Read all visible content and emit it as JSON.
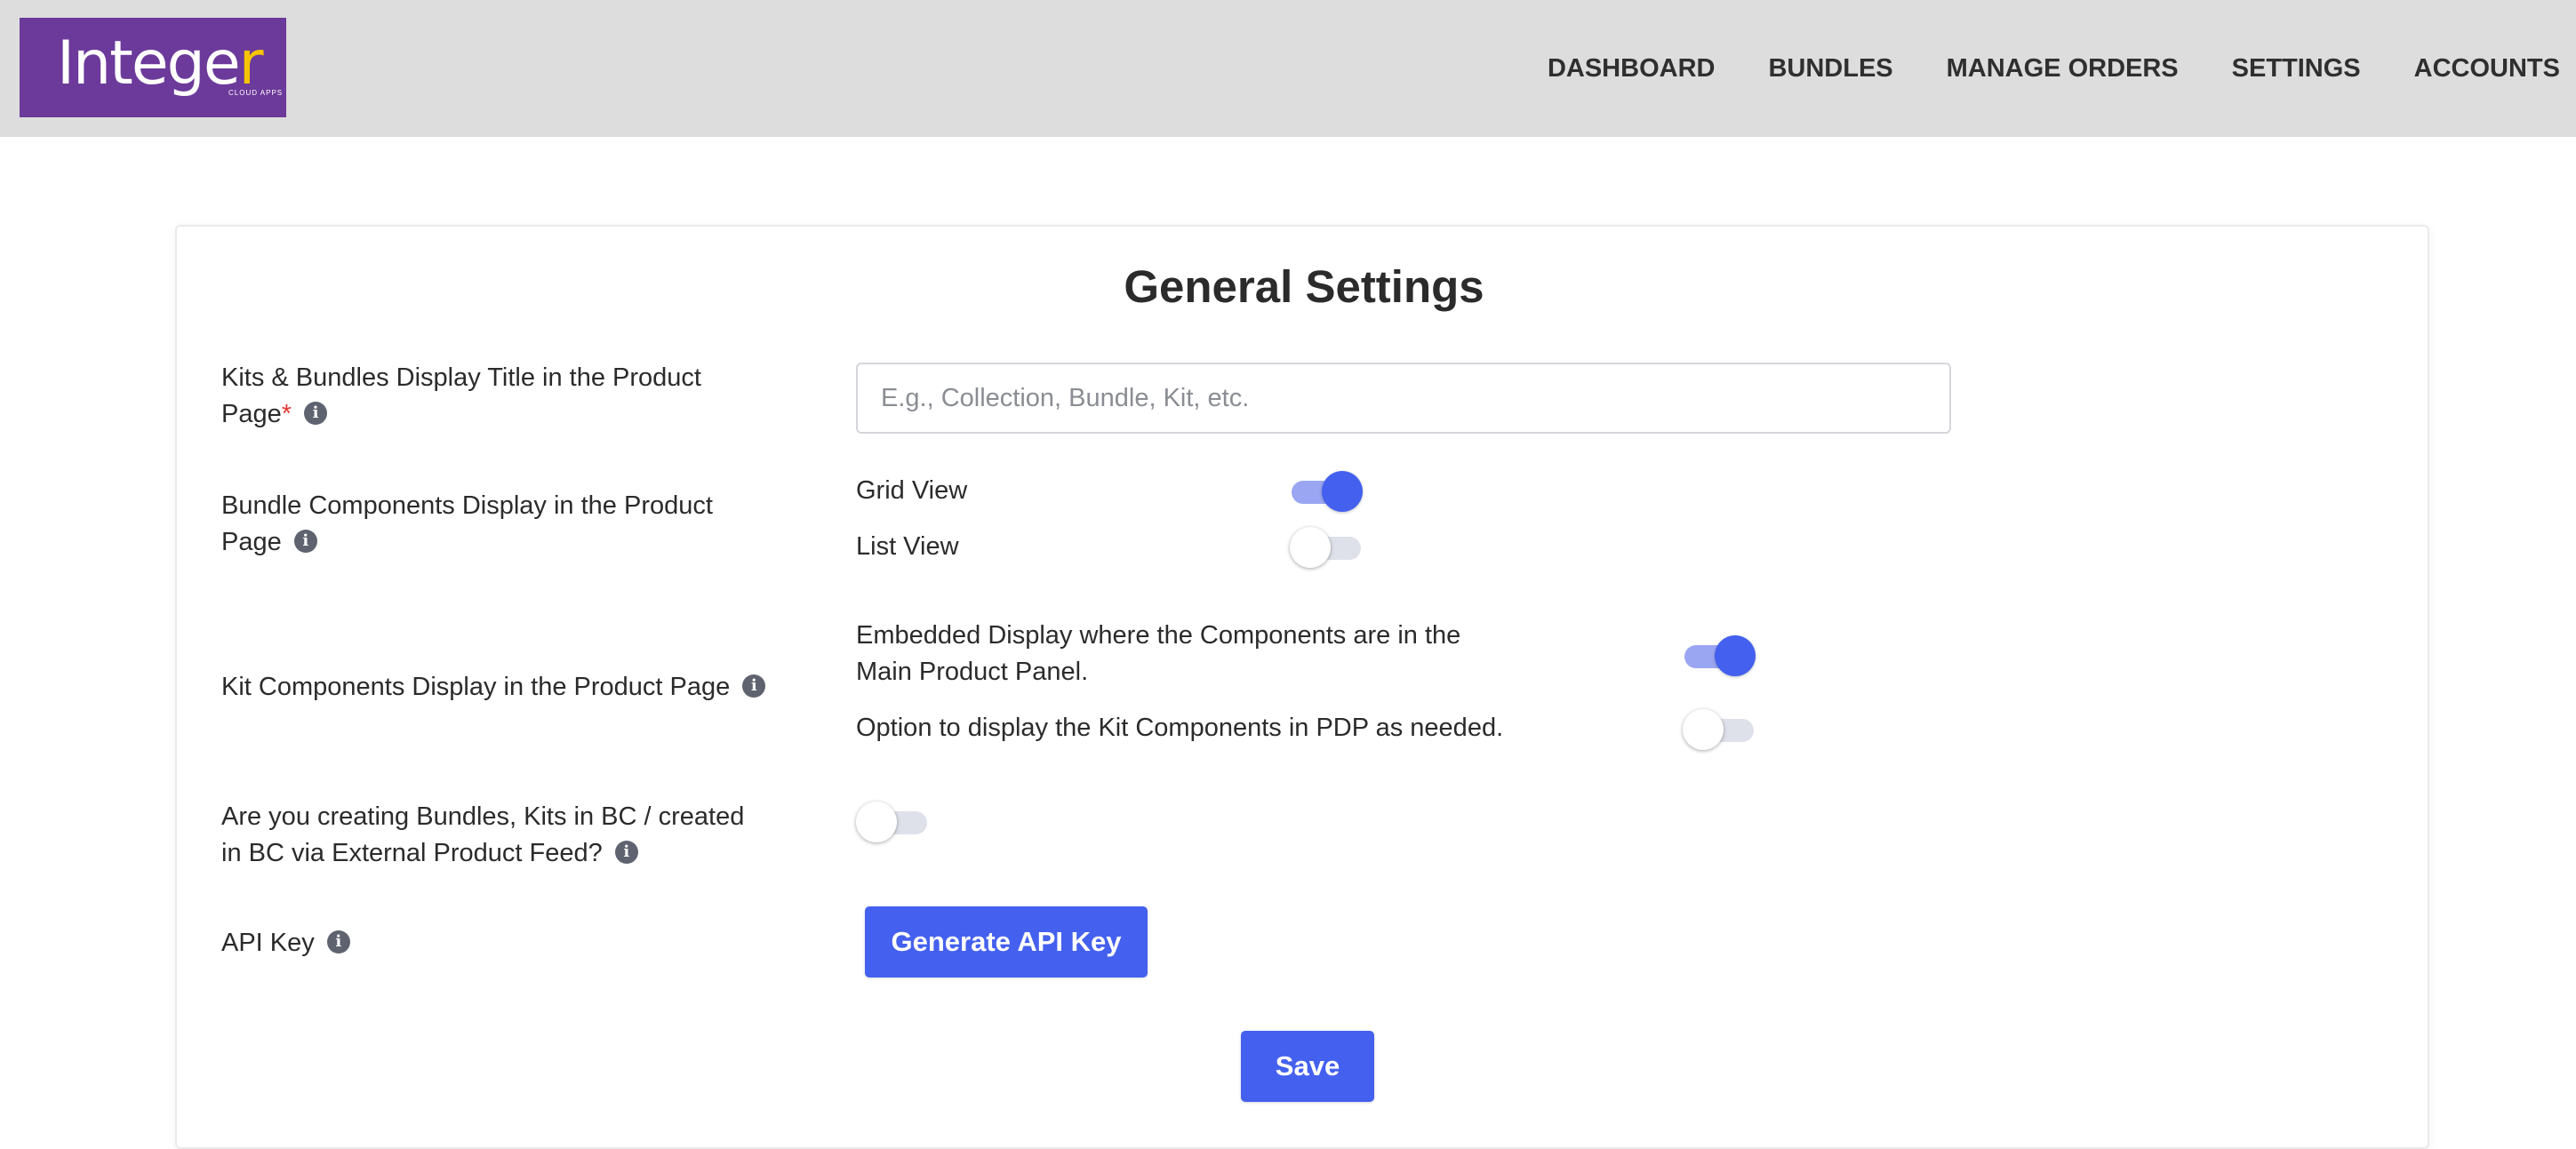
{
  "header": {
    "logo": {
      "text_main": "Intege",
      "text_accent": "r",
      "subtitle": "CLOUD APPS",
      "bg_color": "#6c3a9a",
      "accent_color": "#f5c400"
    },
    "nav": [
      "DASHBOARD",
      "BUNDLES",
      "MANAGE ORDERS",
      "SETTINGS",
      "ACCOUNTS"
    ]
  },
  "settings": {
    "title": "General Settings",
    "display_title": {
      "label": "Kits & Bundles Display Title in the Product Page",
      "required_mark": "*",
      "placeholder": "E.g., Collection, Bundle, Kit, etc.",
      "value": ""
    },
    "bundle_components": {
      "label": "Bundle Components Display in the Product Page",
      "options": [
        {
          "label": "Grid View",
          "enabled": true
        },
        {
          "label": "List View",
          "enabled": false
        }
      ]
    },
    "kit_components": {
      "label": "Kit Components Display in the Product Page",
      "options": [
        {
          "label": "Embedded Display where the Components are in the Main Product Panel.",
          "enabled": true
        },
        {
          "label": "Option to display the Kit Components in PDP as needed.",
          "enabled": false
        }
      ]
    },
    "external_feed": {
      "label": "Are you creating Bundles, Kits in BC / created in BC via External Product Feed?",
      "enabled": false
    },
    "api_key": {
      "label": "API Key",
      "button_label": "Generate API Key"
    },
    "save_label": "Save",
    "info_glyph": "i"
  },
  "colors": {
    "primary": "#4460ee",
    "toggle_on_track": "#9aa6f2",
    "toggle_off_track": "#dfe1ea",
    "header_bg": "#dddddd"
  }
}
